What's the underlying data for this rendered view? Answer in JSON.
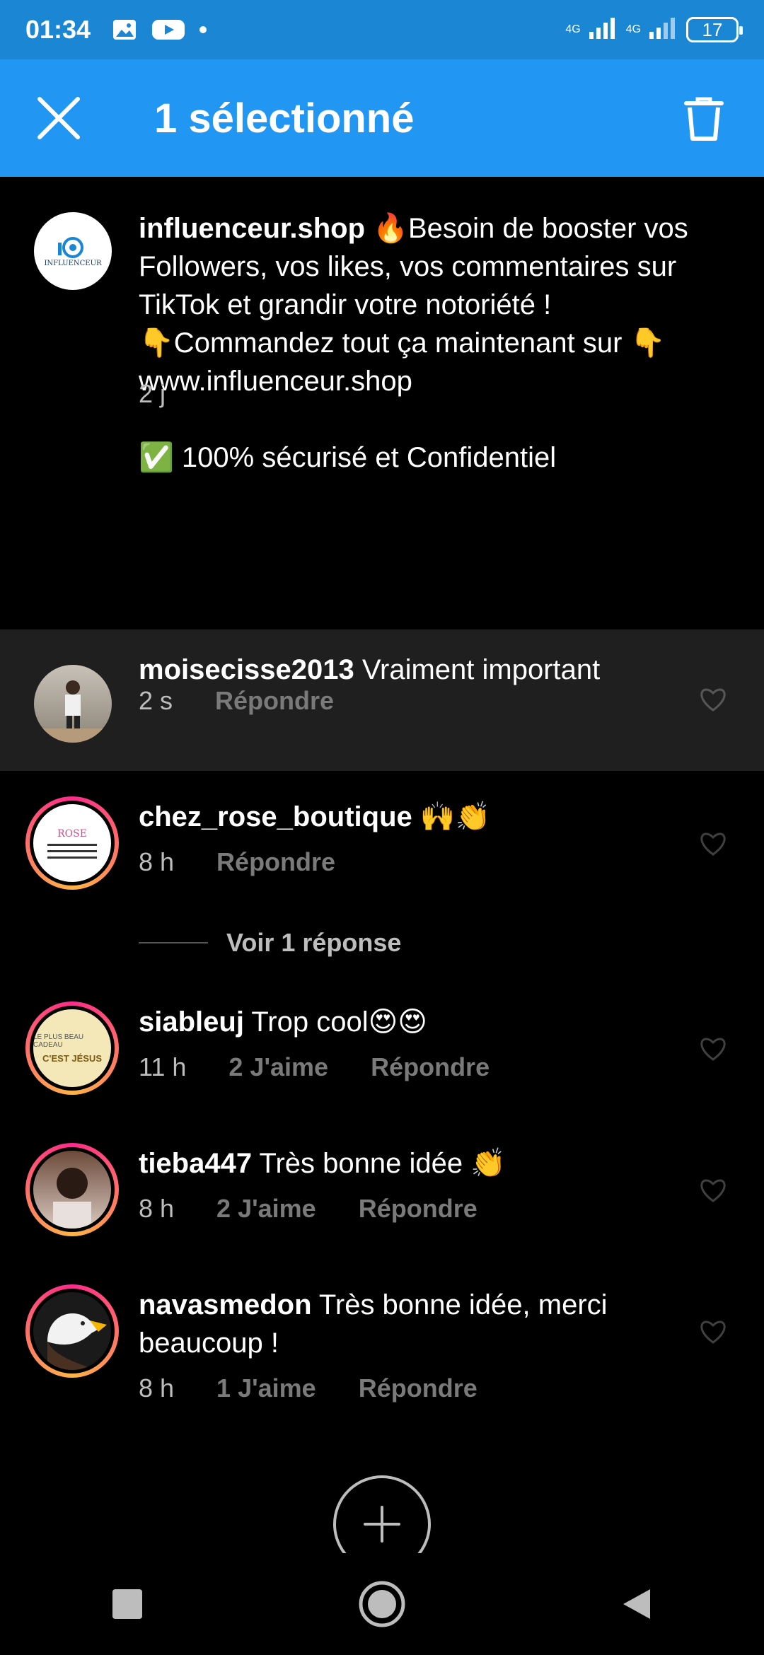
{
  "status_bar": {
    "time": "01:34",
    "network1": "4G",
    "network2": "4G",
    "battery": "17"
  },
  "app_bar": {
    "title": "1 sélectionné"
  },
  "post": {
    "username": "influenceur.shop",
    "line1": "🔥Besoin de booster vos Followers, vos likes, vos commentaires sur TikTok et grandir votre notoriété !",
    "line2": "👇Commandez tout ça maintenant sur 👇",
    "line3": " www.influenceur.shop",
    "line4": "✅ 100% sécurisé et Confidentiel",
    "time": "2 j"
  },
  "comments": [
    {
      "username": "moisecisse2013",
      "text": "Vraiment important",
      "time": "2 s",
      "likes": "",
      "reply": "Répondre"
    },
    {
      "username": "chez_rose_boutique",
      "text": "🙌👏",
      "time": "8 h",
      "likes": "",
      "reply": "Répondre"
    },
    {
      "username": "siableuj",
      "text": "Trop cool😍😍",
      "time": "11 h",
      "likes": "2 J'aime",
      "reply": "Répondre"
    },
    {
      "username": "tieba447",
      "text": "Très bonne idée 👏",
      "time": "8 h",
      "likes": "2 J'aime",
      "reply": "Répondre"
    },
    {
      "username": "navasmedon",
      "text": "Très bonne idée, merci beaucoup !",
      "time": "8 h",
      "likes": "1 J'aime",
      "reply": "Répondre"
    }
  ],
  "view_replies": "Voir 1 réponse",
  "icons": {
    "close": "close-icon",
    "trash": "trash-icon",
    "heart": "heart-icon",
    "add": "plus-icon"
  },
  "colors": {
    "status_bar": "#1a86d4",
    "app_bar": "#2196f3",
    "selected_row": "#1f1f1f"
  }
}
